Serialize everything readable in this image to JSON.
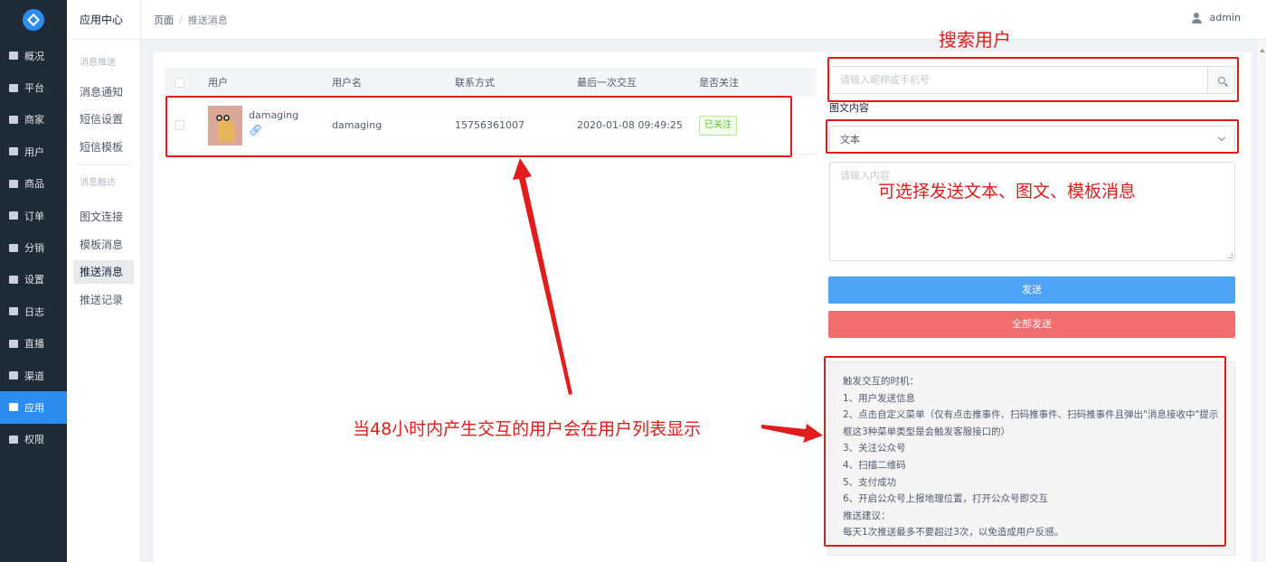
{
  "sidebar": {
    "items": [
      {
        "label": "概况",
        "icon": "dashboard-icon"
      },
      {
        "label": "平台",
        "icon": "monitor-icon"
      },
      {
        "label": "商家",
        "icon": "store-icon"
      },
      {
        "label": "用户",
        "icon": "user-icon"
      },
      {
        "label": "商品",
        "icon": "goods-icon"
      },
      {
        "label": "订单",
        "icon": "order-icon"
      },
      {
        "label": "分销",
        "icon": "distribution-icon"
      },
      {
        "label": "设置",
        "icon": "gear-icon"
      },
      {
        "label": "日志",
        "icon": "log-icon"
      },
      {
        "label": "直播",
        "icon": "live-icon"
      },
      {
        "label": "渠道",
        "icon": "channel-icon"
      },
      {
        "label": "应用",
        "icon": "apps-icon",
        "active": true
      },
      {
        "label": "权限",
        "icon": "lock-icon"
      }
    ]
  },
  "subnav": {
    "title": "应用中心",
    "groups": [
      {
        "title": "消息推送",
        "links": [
          "消息通知",
          "短信设置",
          "短信模板"
        ]
      },
      {
        "title": "消息触达",
        "links": [
          "图文连接",
          "模板消息",
          "推送消息",
          "推送记录"
        ]
      }
    ],
    "active": "推送消息"
  },
  "header": {
    "breadcrumb": [
      "页面",
      "推送消息"
    ],
    "username": "admin"
  },
  "table": {
    "columns": [
      "用户",
      "用户名",
      "联系方式",
      "最后一次交互",
      "是否关注"
    ],
    "rows": [
      {
        "nickname": "damaging",
        "username": "damaging",
        "phone": "15756361007",
        "last_interaction": "2020-01-08 09:49:25",
        "status": "已关注"
      }
    ]
  },
  "form": {
    "search_placeholder": "请输入昵称或手机号",
    "type_label": "图文内容",
    "type_value": "文本",
    "content_placeholder": "请输入内容",
    "send_label": "发送",
    "send_all_label": "全部发送"
  },
  "notice": {
    "lines": [
      "触发交互的时机：",
      "1、用户发送信息",
      "2、点击自定义菜单（仅有点击推事件、扫码推事件、扫码推事件且弹出\"消息接收中\"提示框这3种菜单类型是会触发客服接口的）",
      "3、关注公众号",
      "4、扫描二维码",
      "5、支付成功",
      "6、开启公众号上报地理位置，打开公众号即交互",
      "推送建议：",
      "每天1次推送最多不要超过3次，以免造成用户反感。"
    ]
  },
  "annotations": {
    "search_user": "搜索用户",
    "content_types": "可选择发送文本、图文、模板消息",
    "list_note": "当48小时内产生交互的用户会在用户列表显示"
  },
  "colors": {
    "primary": "#2d8cf0",
    "send_button": "#4ea3f5",
    "send_all_button": "#f26d6d",
    "annotation_red": "#e21b1b",
    "sidebar_bg": "#1e2a36"
  }
}
